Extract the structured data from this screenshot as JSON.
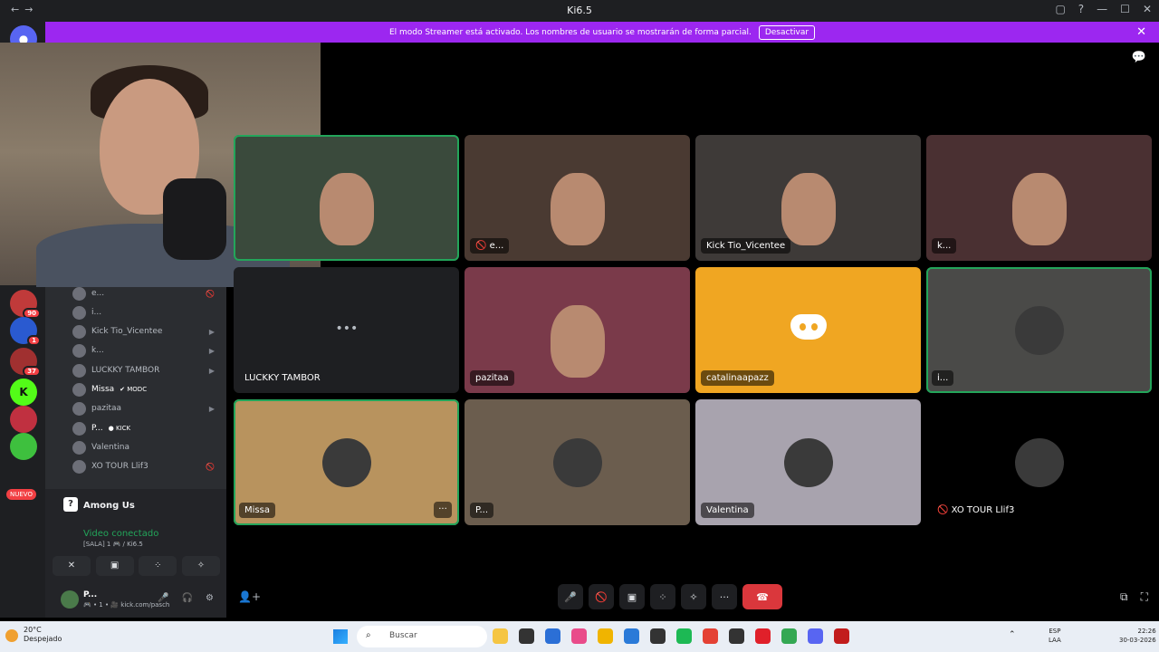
{
  "window": {
    "title": "Ki6.5",
    "nav_back": "←",
    "nav_forward": "→",
    "controls": [
      "▢",
      "?",
      "—",
      "☐",
      "✕"
    ]
  },
  "banner": {
    "text": "El modo Streamer está activado. Los nombres de usuario se mostrarán de forma parcial.",
    "button": "Desactivar",
    "close": "✕"
  },
  "servers": {
    "badges": [
      "90",
      "1",
      "37"
    ],
    "new_label": "NUEVO"
  },
  "voice_members": [
    {
      "name": "e...",
      "icon": "🚫"
    },
    {
      "name": "i...",
      "icon": ""
    },
    {
      "name": "Kick Tio_Vicentee",
      "icon": "▶"
    },
    {
      "name": "k...",
      "icon": "▶"
    },
    {
      "name": "LUCKKY TAMBOR",
      "icon": "▶"
    },
    {
      "name": "Missa",
      "tag": "✔ MODC",
      "icon": ""
    },
    {
      "name": "pazitaa",
      "icon": "▶"
    },
    {
      "name": "P...",
      "tag": "● KICK",
      "icon": ""
    },
    {
      "name": "Valentina",
      "icon": ""
    },
    {
      "name": "XO TOUR Llif3",
      "icon": "🚫"
    }
  ],
  "activity": {
    "game": "Among Us",
    "status": "Video conectado",
    "channel": "[SALA] 1 🎮 / Ki6.5",
    "actions": [
      "✕",
      "▣",
      "⁘",
      "✧"
    ]
  },
  "user": {
    "name": "P...",
    "status": "🎮 • 1 • 🎥 kick.com/pasch",
    "controls": [
      "🎤",
      "⌄",
      "🎧",
      "⌄",
      "⚙"
    ]
  },
  "tiles": [
    {
      "name": "",
      "speaking": true,
      "kind": "cam",
      "color": "#3a4a3c"
    },
    {
      "name": "e...",
      "speaking": false,
      "kind": "cam",
      "color": "#4a3a32",
      "muted": true
    },
    {
      "name": "Kick Tio_Vicentee",
      "speaking": false,
      "kind": "cam",
      "color": "#3e3a38"
    },
    {
      "name": "k...",
      "speaking": false,
      "kind": "cam",
      "color": "#4a3032"
    },
    {
      "name": "LUCKKY TAMBOR",
      "speaking": false,
      "kind": "empty",
      "color": "#1e1f22"
    },
    {
      "name": "pazitaa",
      "speaking": false,
      "kind": "cam",
      "color": "#7a3a4a"
    },
    {
      "name": "catalinaapazz",
      "speaking": false,
      "kind": "discord",
      "color": "#f0a622"
    },
    {
      "name": "i...",
      "speaking": true,
      "kind": "avatar",
      "color": "#4a4a48"
    },
    {
      "name": "Missa",
      "speaking": true,
      "kind": "avatar",
      "color": "#b8935e",
      "more": "···"
    },
    {
      "name": "P...",
      "speaking": false,
      "kind": "avatar",
      "color": "#6b5d4e"
    },
    {
      "name": "Valentina",
      "speaking": false,
      "kind": "avatar",
      "color": "#a8a3ae"
    },
    {
      "name": "XO TOUR Llif3",
      "speaking": false,
      "kind": "avatar",
      "color": "#000000",
      "muted": true
    }
  ],
  "callbar": {
    "buttons": [
      "🎤",
      "⌄",
      "🚫",
      "⌄",
      "▣",
      "⁘",
      "✧",
      "···"
    ],
    "end": "☎"
  },
  "taskbar": {
    "temp": "20°C",
    "weather": "Despejado",
    "search_placeholder": "Buscar",
    "lang_top": "ESP",
    "lang_bottom": "LAA",
    "time": "22:26",
    "date": "30-03-2026",
    "app_colors": [
      "#f5c542",
      "#333",
      "#2b6fd6",
      "#e94b8a",
      "#f0b400",
      "#2a7ad8",
      "#333",
      "#1db954",
      "#e44134",
      "#333",
      "#e0202a",
      "#34a853",
      "#5865f2",
      "#c21c1c"
    ]
  }
}
